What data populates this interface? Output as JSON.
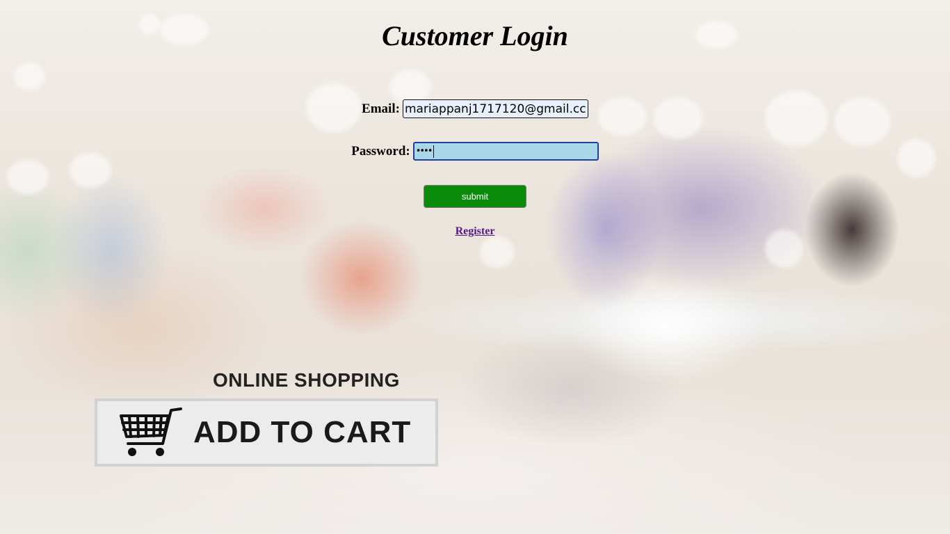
{
  "page": {
    "title": "Customer Login"
  },
  "form": {
    "email_label": "Email:",
    "email_value": "mariappanj1717120@gmail.cc",
    "password_label": "Password:",
    "password_masked": "••••",
    "submit_label": "submit",
    "register_link": "Register"
  },
  "banner": {
    "heading": "ONLINE SHOPPING",
    "button_text": "ADD TO CART",
    "icon": "shopping-cart-icon"
  },
  "colors": {
    "submit_bg": "#0a8c0a",
    "password_bg": "#a8d8e8",
    "link": "#551a8b"
  }
}
